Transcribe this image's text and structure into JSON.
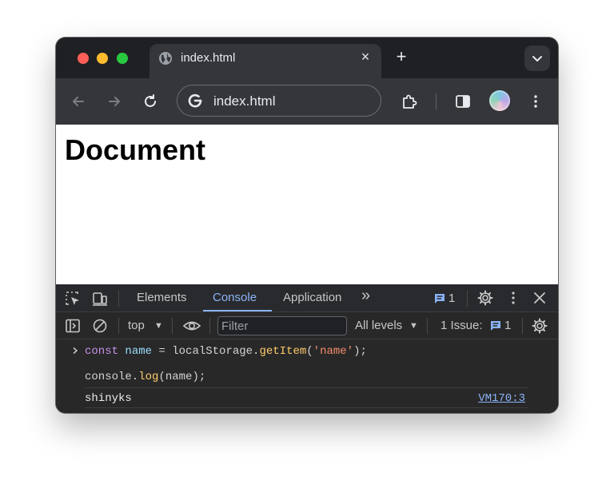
{
  "browser": {
    "tab_title": "index.html",
    "tab_close_glyph": "×",
    "new_tab_glyph": "+",
    "address_value": "index.html"
  },
  "page": {
    "heading": "Document"
  },
  "devtools": {
    "tabs": [
      "Elements",
      "Console",
      "Application"
    ],
    "active_tab": "Console",
    "overflow_glyph": "»",
    "message_count": "1",
    "console_toolbar": {
      "context": "top",
      "filter_placeholder": "Filter",
      "levels": "All levels",
      "issues_label": "1 Issue:",
      "issues_count": "1"
    },
    "console": {
      "input_line_1": {
        "kw": "const",
        "var": "name",
        "op": " = localStorage.",
        "fn": "getItem",
        "open": "(",
        "str": "'name'",
        "close": ");"
      },
      "input_line_2": {
        "obj": "console.",
        "fn": "log",
        "args": "(name);"
      },
      "output_value": "shinyks",
      "output_source": "VM170:3"
    }
  },
  "icons": {
    "tab": "globe-icon",
    "new_tab": "plus-icon",
    "tab_search": "chevron-down-icon",
    "back": "arrow-left-icon",
    "forward": "arrow-right-icon",
    "reload": "reload-icon",
    "site": "google-g-icon",
    "extensions": "puzzle-icon",
    "side_panel": "side-panel-icon",
    "profile": "avatar-icon",
    "menu": "kebab-icon"
  },
  "colors": {
    "accent": "#8ab4f8",
    "traffic_red": "#ff5f57",
    "traffic_yellow": "#febc2e",
    "traffic_green": "#28c840"
  }
}
